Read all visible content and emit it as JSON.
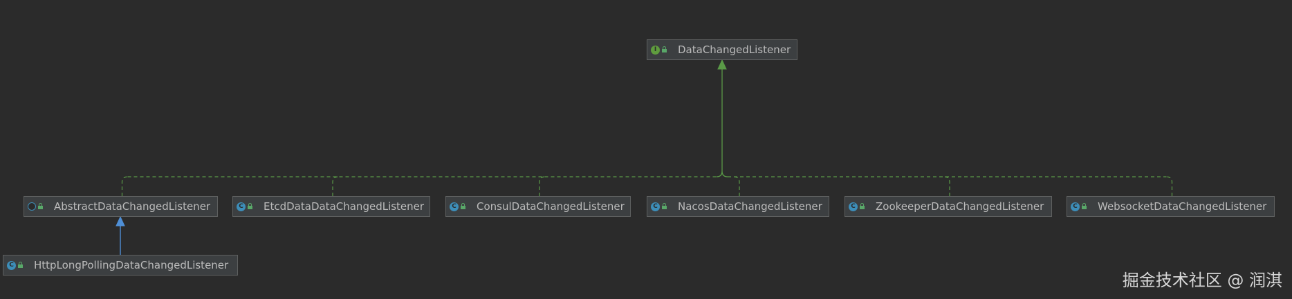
{
  "diagram": {
    "colors": {
      "background": "#2b2b2b",
      "node_fill": "#3c3f41",
      "node_border": "#5e6060",
      "implements_edge": "#5a9a47",
      "extends_edge": "#4f8fd6",
      "text": "#bbbbbb"
    },
    "nodes": [
      {
        "id": "data-changed-listener",
        "label": "DataChangedListener",
        "kind": "interface",
        "badge_icon": "interface-icon"
      },
      {
        "id": "abstract-data-changed-listener",
        "label": "AbstractDataChangedListener",
        "kind": "abstract-class",
        "badge_icon": "abstract-class-icon"
      },
      {
        "id": "etcd-data-data-changed-listener",
        "label": "EtcdDataDataChangedListener",
        "kind": "class",
        "badge_icon": "class-icon"
      },
      {
        "id": "consul-data-changed-listener",
        "label": "ConsulDataChangedListener",
        "kind": "class",
        "badge_icon": "class-icon"
      },
      {
        "id": "nacos-data-changed-listener",
        "label": "NacosDataChangedListener",
        "kind": "class",
        "badge_icon": "class-icon"
      },
      {
        "id": "zookeeper-data-changed-listener",
        "label": "ZookeeperDataChangedListener",
        "kind": "class",
        "badge_icon": "class-icon"
      },
      {
        "id": "websocket-data-changed-listener",
        "label": "WebsocketDataChangedListener",
        "kind": "class",
        "badge_icon": "class-icon"
      },
      {
        "id": "http-long-polling-data-changed-listener",
        "label": "HttpLongPollingDataChangedListener",
        "kind": "class",
        "badge_icon": "class-icon"
      }
    ],
    "edges": [
      {
        "from": "abstract-data-changed-listener",
        "to": "data-changed-listener",
        "type": "implements"
      },
      {
        "from": "etcd-data-data-changed-listener",
        "to": "data-changed-listener",
        "type": "implements"
      },
      {
        "from": "consul-data-changed-listener",
        "to": "data-changed-listener",
        "type": "implements"
      },
      {
        "from": "nacos-data-changed-listener",
        "to": "data-changed-listener",
        "type": "implements"
      },
      {
        "from": "zookeeper-data-changed-listener",
        "to": "data-changed-listener",
        "type": "implements"
      },
      {
        "from": "websocket-data-changed-listener",
        "to": "data-changed-listener",
        "type": "implements"
      },
      {
        "from": "http-long-polling-data-changed-listener",
        "to": "abstract-data-changed-listener",
        "type": "extends"
      }
    ]
  },
  "watermark": "掘金技术社区 @ 润淇"
}
